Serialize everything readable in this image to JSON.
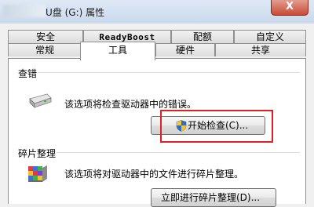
{
  "window": {
    "title": "U盘 (G:) 属性",
    "close_label": "X"
  },
  "tabs": {
    "row1": [
      "安全",
      "ReadyBoost",
      "配额",
      "自定义"
    ],
    "row2": [
      "常规",
      "工具",
      "硬件",
      "共享"
    ],
    "active": "工具"
  },
  "error_check": {
    "group_title": "查错",
    "description": "该选项将检查驱动器中的错误。",
    "button_label": "开始检查(C)..."
  },
  "defrag": {
    "group_title": "碎片整理",
    "description": "该选项将对驱动器中的文件进行碎片整理。",
    "button_label": "立即进行碎片整理(D)..."
  },
  "colors": {
    "highlight": "#e02020",
    "titlebar": "#c9d9ec",
    "close_button": "#c74b36"
  }
}
